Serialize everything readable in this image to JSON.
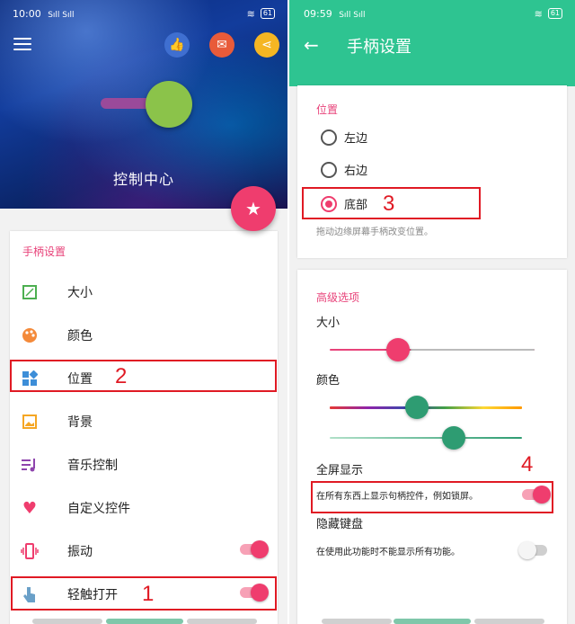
{
  "left": {
    "status": {
      "time": "10:00",
      "signal": "Sıll Sıll",
      "battery": "61"
    },
    "hero_title": "控制中心",
    "card_title": "手柄设置",
    "items": [
      {
        "label": "大小",
        "icon": "size-icon"
      },
      {
        "label": "颜色",
        "icon": "palette-icon"
      },
      {
        "label": "位置",
        "icon": "position-icon"
      },
      {
        "label": "背景",
        "icon": "image-icon"
      },
      {
        "label": "音乐控制",
        "icon": "music-icon"
      },
      {
        "label": "自定义控件",
        "icon": "heart-icon"
      },
      {
        "label": "振动",
        "icon": "vibrate-icon",
        "toggle": true
      },
      {
        "label": "轻触打开",
        "icon": "touch-icon",
        "toggle": true
      }
    ],
    "callouts": {
      "c1": "1",
      "c2": "2"
    }
  },
  "right": {
    "status": {
      "time": "09:59",
      "signal": "Sıll Sıll",
      "battery": "61"
    },
    "title": "手柄设置",
    "position_section": "位置",
    "options": [
      "左边",
      "右边",
      "底部"
    ],
    "selected": "底部",
    "hint": "拖动边缘屏幕手柄改变位置。",
    "advanced_section": "高级选项",
    "size_label": "大小",
    "color_label": "颜色",
    "fullscreen_label": "全屏显示",
    "fullscreen_desc": "在所有东西上显示句柄控件，例如锁屏。",
    "fullscreen_on": true,
    "hide_keyboard_label": "隐藏键盘",
    "hide_keyboard_desc": "在使用此功能时不能显示所有功能。",
    "hide_keyboard_on": false,
    "callouts": {
      "c3": "3",
      "c4": "4"
    }
  },
  "colors": {
    "accent": "#ef3d6e",
    "green": "#2ec491",
    "heading": "#e8437a"
  }
}
